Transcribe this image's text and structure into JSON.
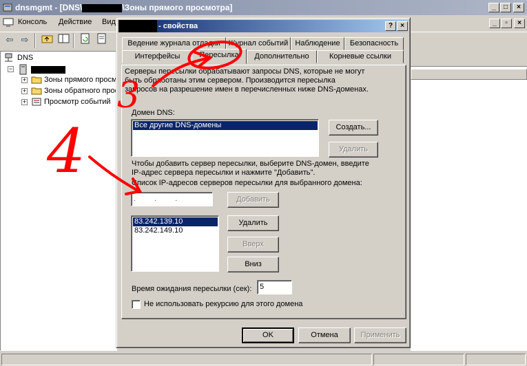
{
  "main_window": {
    "title_prefix": "dnsmgmt - [DNS\\",
    "title_suffix": "\\Зоны прямого просмотра]",
    "menu": [
      "Консоль",
      "Действие",
      "Вид"
    ],
    "tree": {
      "root": "DNS",
      "children": [
        "Зоны прямого просмотра",
        "Зоны обратного просмотра",
        "Просмотр событий"
      ]
    }
  },
  "dialog": {
    "title": "- свойства",
    "tabs_row1": [
      "Ведение журнала отладки",
      "Журнал событий",
      "Наблюдение",
      "Безопасность"
    ],
    "tabs_row2": [
      "Интерфейсы",
      "Пересылка",
      "Дополнительно",
      "Корневые ссылки"
    ],
    "active_tab": "Пересылка",
    "intro_lines": [
      "Серверы пересылки обрабатывают запросы DNS, которые не могут",
      "быть обработаны этим сервером. Производится пересылка",
      "запросов на разрешение имен в перечисленных ниже DNS-доменах."
    ],
    "domain_label": "Домен DNS:",
    "domain_items": [
      "Все другие DNS-домены"
    ],
    "create_button": "Создать...",
    "delete_domain_button": "Удалить",
    "instruction_lines": [
      "Чтобы добавить сервер пересылки, выберите DNS-домен, введите",
      "IP-адрес сервера пересылки и нажмите \"Добавить\"."
    ],
    "ip_list_label": "Список IP-адресов серверов пересылки для выбранного домена:",
    "ip_input_value": ". . .",
    "add_button": "Добавить",
    "ip_items": [
      "83.242.139.10",
      "83.242.149.10"
    ],
    "delete_button": "Удалить",
    "up_button": "Вверх",
    "down_button": "Вниз",
    "timeout_label": "Время ожидания пересылки (сек):",
    "timeout_value": "5",
    "no_recursion_label": "Не использовать рекурсию для этого домена",
    "ok_button": "OK",
    "cancel_button": "Отмена",
    "apply_button": "Применить"
  },
  "annotations": {
    "marker_3": "3",
    "marker_4": "4",
    "ink_color": "#ff0000"
  }
}
